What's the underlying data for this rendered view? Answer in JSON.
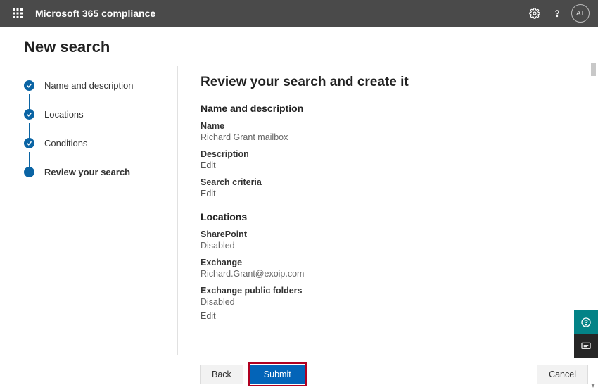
{
  "header": {
    "app_title": "Microsoft 365 compliance",
    "avatar_initials": "AT"
  },
  "page": {
    "title": "New search"
  },
  "sidebar": {
    "steps": [
      {
        "label": "Name and description"
      },
      {
        "label": "Locations"
      },
      {
        "label": "Conditions"
      },
      {
        "label": "Review your search"
      }
    ]
  },
  "review": {
    "heading": "Review your search and create it",
    "sections": {
      "name_desc": {
        "title": "Name and description",
        "name_label": "Name",
        "name_value": "Richard Grant mailbox",
        "desc_label": "Description",
        "desc_edit": "Edit",
        "criteria_label": "Search criteria",
        "criteria_edit": "Edit"
      },
      "locations": {
        "title": "Locations",
        "sharepoint_label": "SharePoint",
        "sharepoint_value": "Disabled",
        "exchange_label": "Exchange",
        "exchange_value": "Richard.Grant@exoip.com",
        "public_label": "Exchange public folders",
        "public_value": "Disabled",
        "loc_edit": "Edit"
      }
    }
  },
  "footer": {
    "back": "Back",
    "submit": "Submit",
    "cancel": "Cancel"
  }
}
